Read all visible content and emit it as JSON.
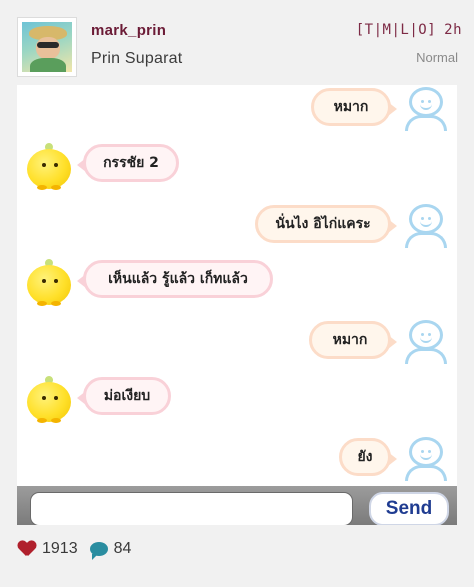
{
  "header": {
    "username": "mark_prin",
    "full_name": "Prin Suparat",
    "nav": {
      "open_bracket": "[",
      "links": [
        "T",
        "M",
        "L",
        "O"
      ],
      "separator": "|",
      "close_bracket": "]",
      "time": "2h"
    },
    "filter": "Normal"
  },
  "post": {
    "messages": [
      {
        "side": "right",
        "text": "หมาก"
      },
      {
        "side": "left",
        "text": "กรรชัย 2"
      },
      {
        "side": "right",
        "text": "นั่นไง อิไก่แคระ"
      },
      {
        "side": "left",
        "text": "เห็นแล้ว รู้แล้ว เก็ทแล้ว"
      },
      {
        "side": "right",
        "text": "หมาก"
      },
      {
        "side": "left",
        "text": "ม่อเงียบ"
      },
      {
        "side": "right",
        "text": "ยัง"
      }
    ],
    "send_label": "Send"
  },
  "footer": {
    "likes": "1913",
    "comments": "84"
  },
  "colors": {
    "background": "#f1f1f1",
    "username": "#6b1b36",
    "nav": "#7d2a45",
    "heart": "#b0202c",
    "comment": "#2a8da0",
    "send_text": "#1f3c91"
  }
}
